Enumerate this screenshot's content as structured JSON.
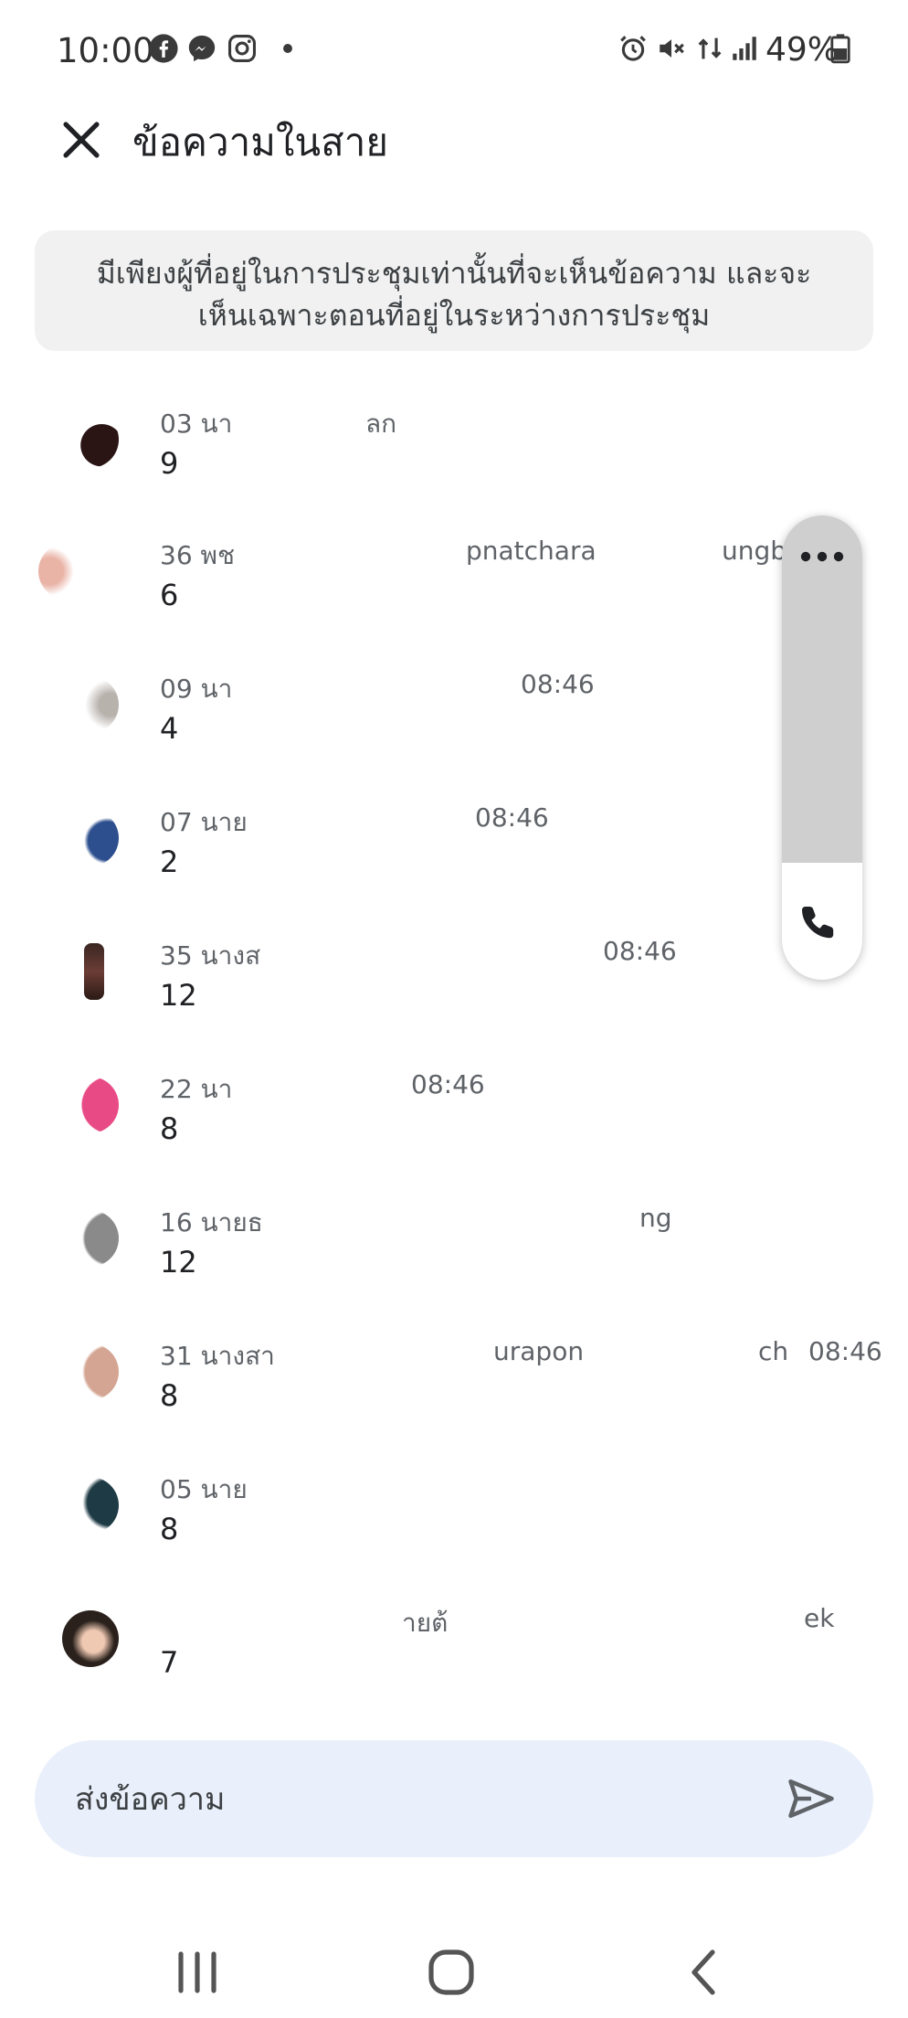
{
  "status_bar": {
    "time": "10:00",
    "left_icons": [
      "facebook-icon",
      "messenger-icon",
      "instagram-icon",
      "dot-icon"
    ],
    "right_icons": [
      "alarm-icon",
      "mute-icon",
      "data-icon",
      "signal-icon"
    ],
    "battery_percent": "49%"
  },
  "header": {
    "title": "ข้อความในสาย"
  },
  "notice": {
    "line1": "มีเพียงผู้ที่อยู่ในการประชุมเท่านั้นที่จะเห็นข้อความ และจะ",
    "line2": "เห็นเฉพาะตอนที่อยู่ในระหว่างการประชุม"
  },
  "messages": [
    {
      "sender": "03 นา",
      "sender_tail": "ลก",
      "time": "",
      "text": "9"
    },
    {
      "sender": "36 พช",
      "sender_tail": "pnatchara",
      "sender_end": "ungb",
      "time": "",
      "text": "6"
    },
    {
      "sender": "09 นา",
      "sender_tail": "",
      "time": "08:46",
      "text": "4"
    },
    {
      "sender": "07 นาย",
      "sender_tail": "",
      "time": "08:46",
      "text": "2"
    },
    {
      "sender": "35 นางส",
      "sender_tail": "",
      "time": "08:46",
      "text": "12"
    },
    {
      "sender": "22 นา",
      "sender_tail": "",
      "time": "08:46",
      "text": "8"
    },
    {
      "sender": "16 นายธ",
      "sender_tail": "ng",
      "time": "",
      "text": "12"
    },
    {
      "sender": "31 นางสา",
      "sender_tail": "urapon",
      "sender_end": "ch",
      "time": "08:46",
      "text": "8"
    },
    {
      "sender": "05 นาย",
      "sender_tail": "",
      "time": "",
      "text": "8"
    },
    {
      "sender": "",
      "sender_tail": "ายต้",
      "sender_end": "ek",
      "time": "",
      "text": "7"
    }
  ],
  "side_panel": {
    "more_icon": "more-horizontal-icon",
    "call_icon": "phone-icon"
  },
  "composer": {
    "placeholder": "ส่งข้อความ",
    "send_icon": "send-icon"
  },
  "nav_bar": {
    "icons": [
      "recent-apps-icon",
      "home-icon",
      "back-icon"
    ]
  },
  "colors": {
    "notice_bg": "#f1f1f1",
    "composer_bg": "#eaf0fb",
    "side_panel_top": "#cfcfcf",
    "secondary_text": "#5f6368"
  }
}
